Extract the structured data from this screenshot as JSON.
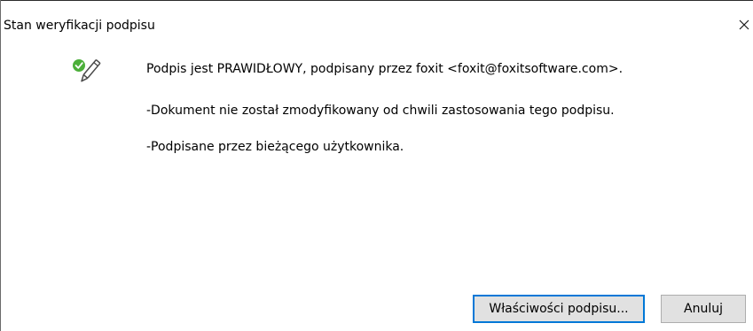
{
  "window": {
    "title": "Stan weryfikacji podpisu",
    "close_icon": "close-icon"
  },
  "status": {
    "icon": "signature-valid-icon",
    "icon_colors": {
      "check_green": "#4caf3a",
      "pen_outline": "#4a4a4a"
    },
    "lines": [
      "Podpis jest PRAWIDŁOWY, podpisany przez foxit <foxit@foxitsoftware.com>.",
      "-Dokument nie został zmodyfikowany od chwili zastosowania tego podpisu.",
      "-Podpisane przez bieżącego użytkownika."
    ]
  },
  "buttons": {
    "properties_label": "Właściwości podpisu...",
    "cancel_label": "Anuluj"
  },
  "colors": {
    "default_button_border": "#0078d7",
    "button_face": "#e1e1e1"
  }
}
